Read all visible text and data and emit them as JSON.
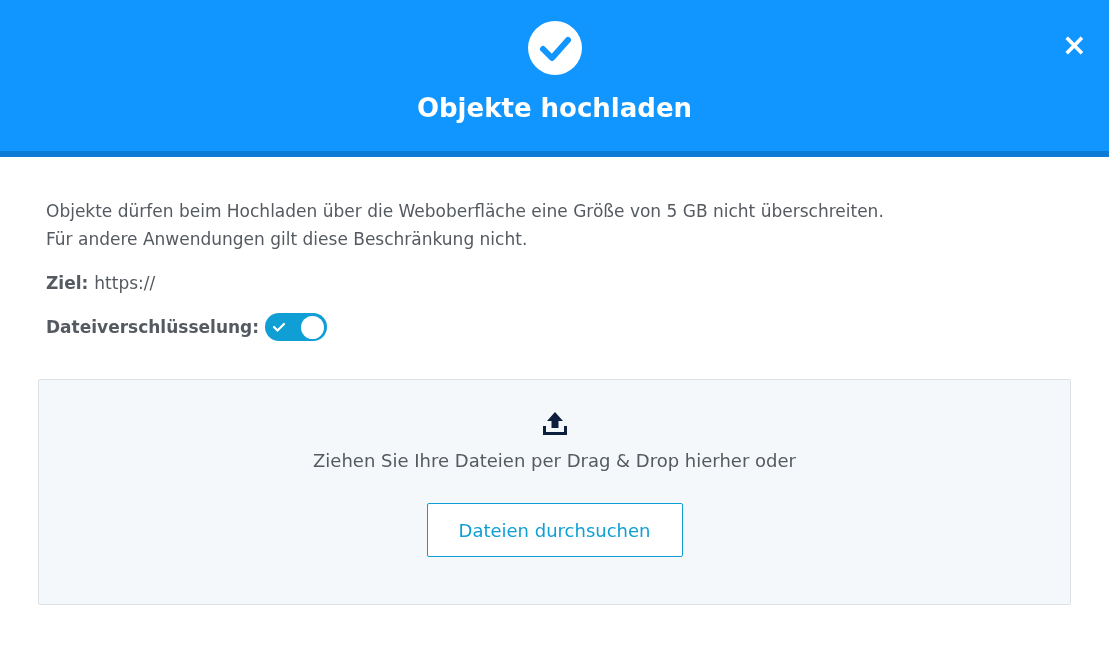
{
  "dialog": {
    "title": "Objekte hochladen",
    "close": "×"
  },
  "info": "Objekte dürfen beim Hochladen über die Weboberfläche eine Größe von 5 GB nicht überschreiten.\nFür andere Anwendungen gilt diese Beschränkung nicht.",
  "target": {
    "label": "Ziel:",
    "value": "https://"
  },
  "encryption": {
    "label": "Dateiverschlüsselung:",
    "on": true
  },
  "dropzone": {
    "text": "Ziehen Sie Ihre Dateien per Drag & Drop hierher oder",
    "button": "Dateien durchsuchen"
  }
}
